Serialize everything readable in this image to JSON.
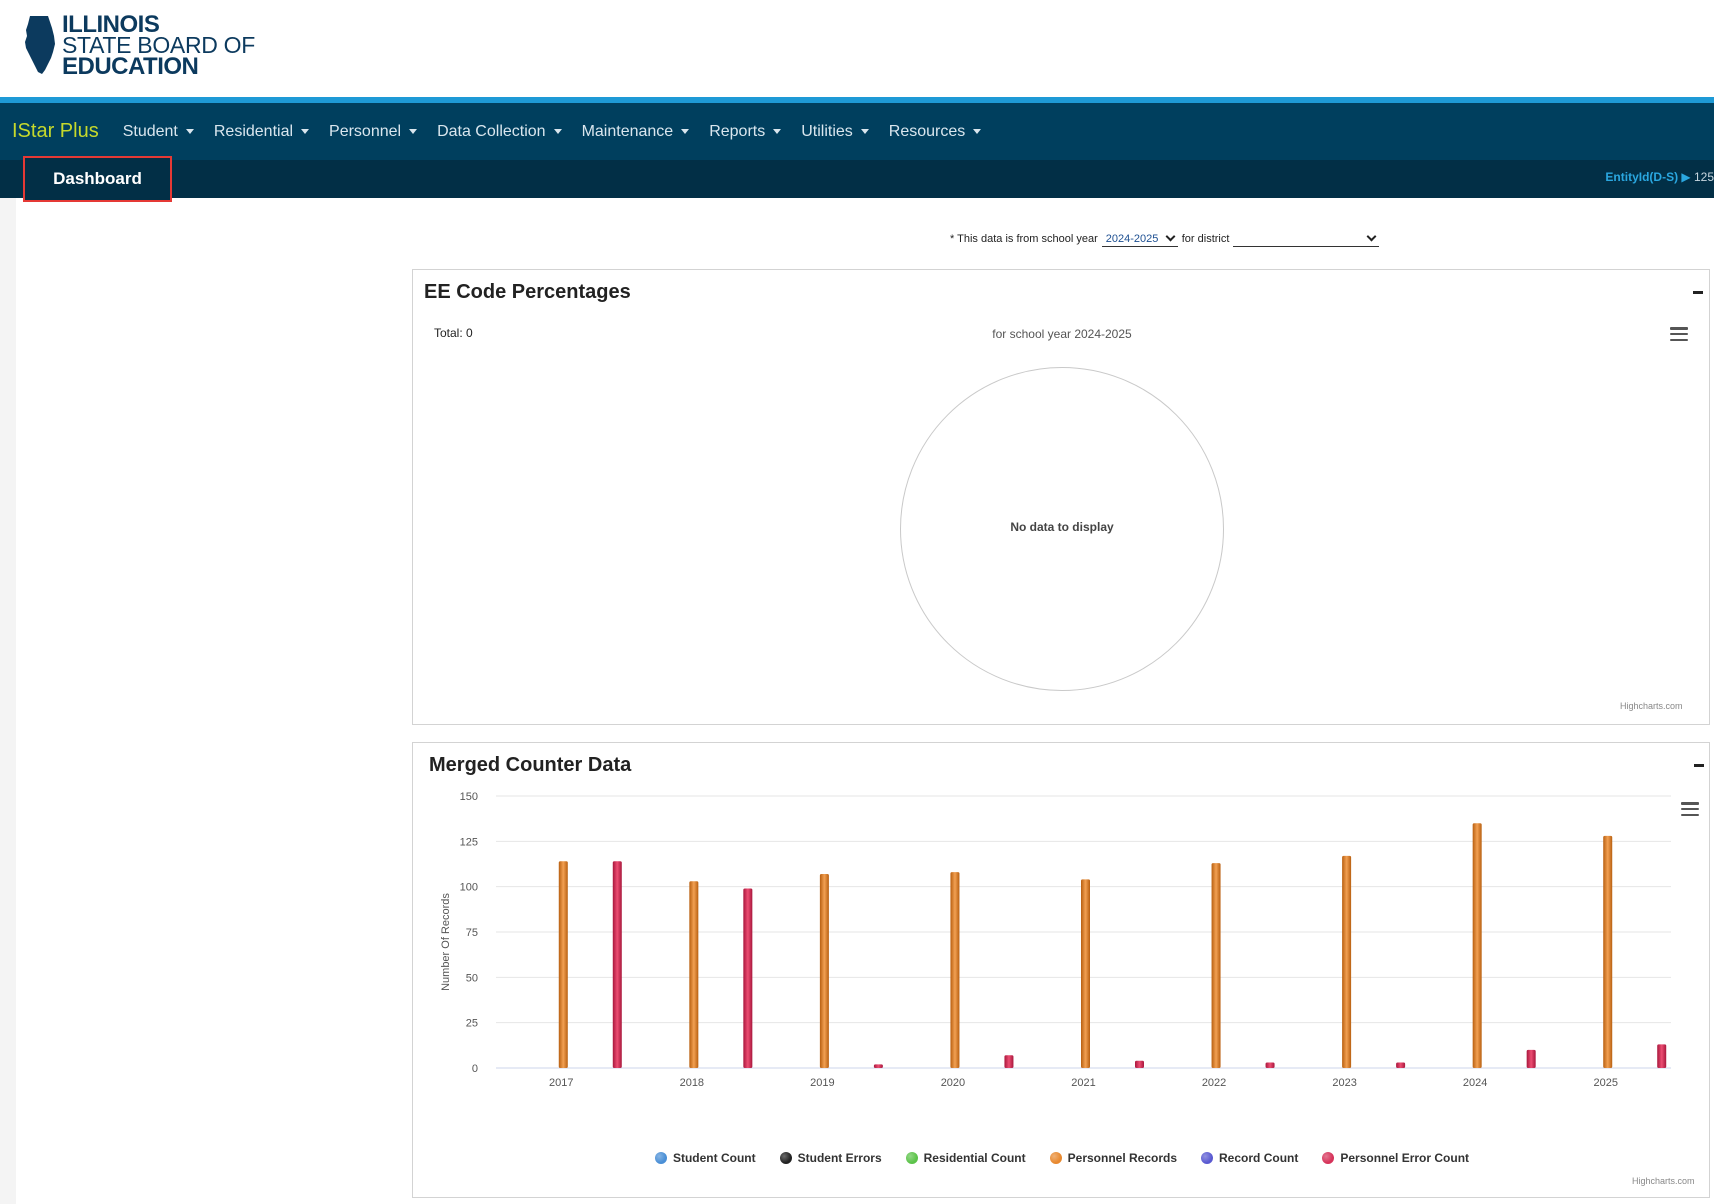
{
  "logo": {
    "line1": "ILLINOIS",
    "line2": "STATE BOARD OF",
    "line3": "EDUCATION"
  },
  "nav": {
    "brand": "IStar Plus",
    "items": [
      {
        "label": "Student"
      },
      {
        "label": "Residential"
      },
      {
        "label": "Personnel"
      },
      {
        "label": "Data Collection"
      },
      {
        "label": "Maintenance"
      },
      {
        "label": "Reports"
      },
      {
        "label": "Utilities"
      },
      {
        "label": "Resources"
      }
    ]
  },
  "subnav": {
    "active_tab": "Dashboard",
    "entity_label": "EntityId(D-S) ▶",
    "entity_value": "125"
  },
  "filter": {
    "prefix": "* This data is from school year",
    "school_year": "2024-2025",
    "mid": "for district",
    "district": ""
  },
  "ee_panel": {
    "title": "EE Code Percentages",
    "total": "Total: 0",
    "subtitle": "for school year 2024-2025",
    "no_data": "No data to display",
    "credit": "Highcharts.com"
  },
  "merged_panel": {
    "title": "Merged Counter Data",
    "credit": "Highcharts.com"
  },
  "chart_data": {
    "type": "bar",
    "title": "Merged Counter Data",
    "ylabel": "Number Of Records",
    "ylim": [
      0,
      150
    ],
    "yticks": [
      0,
      25,
      50,
      75,
      100,
      125,
      150
    ],
    "categories": [
      "2017",
      "2018",
      "2019",
      "2020",
      "2021",
      "2022",
      "2023",
      "2024",
      "2025"
    ],
    "legend_position": "bottom",
    "grid": true,
    "series": [
      {
        "name": "Student Count",
        "color": "#4a8fd6",
        "values": [
          0,
          0,
          0,
          0,
          0,
          0,
          0,
          0,
          0
        ]
      },
      {
        "name": "Student Errors",
        "color": "#222222",
        "values": [
          0,
          0,
          0,
          0,
          0,
          0,
          0,
          0,
          0
        ]
      },
      {
        "name": "Residential Count",
        "color": "#5cc34a",
        "values": [
          0,
          0,
          0,
          0,
          0,
          0,
          0,
          0,
          0
        ]
      },
      {
        "name": "Personnel Records",
        "color": "#e8892f",
        "values": [
          114,
          103,
          107,
          108,
          104,
          113,
          117,
          135,
          128
        ]
      },
      {
        "name": "Record Count",
        "color": "#5a5ad1",
        "values": [
          0,
          0,
          0,
          0,
          0,
          0,
          0,
          0,
          0
        ]
      },
      {
        "name": "Personnel Error Count",
        "color": "#d6335a",
        "values": [
          114,
          99,
          2,
          7,
          4,
          3,
          3,
          10,
          13
        ]
      }
    ]
  }
}
